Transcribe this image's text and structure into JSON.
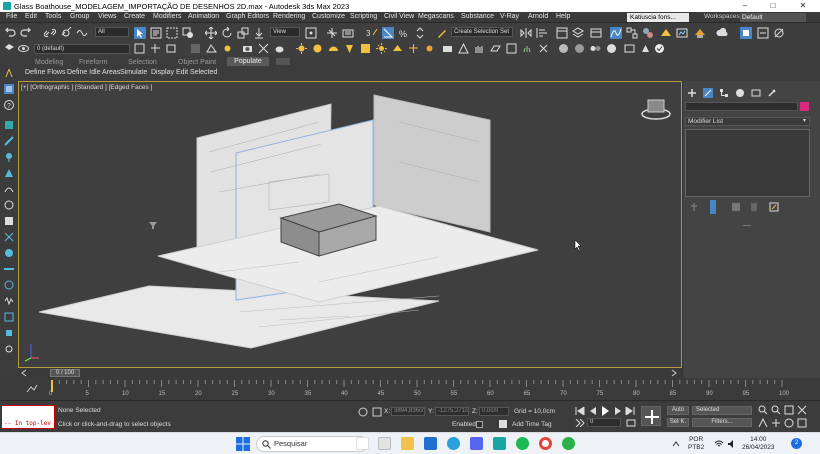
{
  "window": {
    "title": "Glass Boathouse_MODELAGEM_IMPORTAÇÃO DE DESENHOS 2D.max - Autodesk 3ds Max 2023",
    "controls": [
      "–",
      "□",
      "✕"
    ]
  },
  "menubar": {
    "items": [
      "File",
      "Edit",
      "Tools",
      "Group",
      "Views",
      "Create",
      "Modifiers",
      "Animation",
      "Graph Editors",
      "Rendering",
      "Customize",
      "Scripting",
      "Civil View",
      "Megascans",
      "Substance",
      "V-Ray",
      "Arnold",
      "Help"
    ],
    "user": "Katiuscia fons...",
    "workspaces_label": "Workspaces:",
    "workspace_value": "Default"
  },
  "toolbar": {
    "filter_select": "All",
    "view_select": "View",
    "named_selection": "Create Selection Set",
    "layer_select": "0 (default)"
  },
  "ribbon": {
    "tabs": [
      "Modeling",
      "Freeform",
      "Selection",
      "Object Paint",
      "Populate"
    ],
    "active_tab": "Populate",
    "buttons": [
      "Define Flows",
      "Define Idle Areas",
      "Simulate",
      "Display",
      "Edit Selected"
    ]
  },
  "viewport": {
    "label": "[+] [Orthographic ] [Standard ] [Edged Faces ]"
  },
  "command_panel": {
    "modifier_list": "Modifier List",
    "swatch_color": "#d8297a"
  },
  "timeline": {
    "frame_indicator": "0 / 100",
    "ticks": [
      "0",
      "5",
      "10",
      "15",
      "20",
      "25",
      "30",
      "35",
      "40",
      "45",
      "50",
      "55",
      "60",
      "65",
      "70",
      "75",
      "80",
      "85",
      "90",
      "95",
      "100"
    ]
  },
  "status": {
    "maxscript_text": "-- In top-lev",
    "selection_status": "None Selected",
    "prompt": "Click or click-and-drag to select objects",
    "x_label": "X:",
    "x_value": "3894,836cm",
    "y_label": "Y:",
    "y_value": "-1275,271c",
    "z_label": "Z:",
    "z_value": "0,0cm",
    "grid": "Grid = 10,0cm",
    "enabled": "Enabled:",
    "add_time_tag": "Add Time Tag",
    "auto": "Auto",
    "set_key": "Set K.",
    "selected": "Selected",
    "filters": "Filters...",
    "frame_value": "0"
  },
  "taskbar": {
    "search": "Pesquisar",
    "lang_line1": "POR",
    "lang_line2": "PTB2",
    "time": "14:00",
    "date": "26/04/2023",
    "notifications": "2"
  }
}
